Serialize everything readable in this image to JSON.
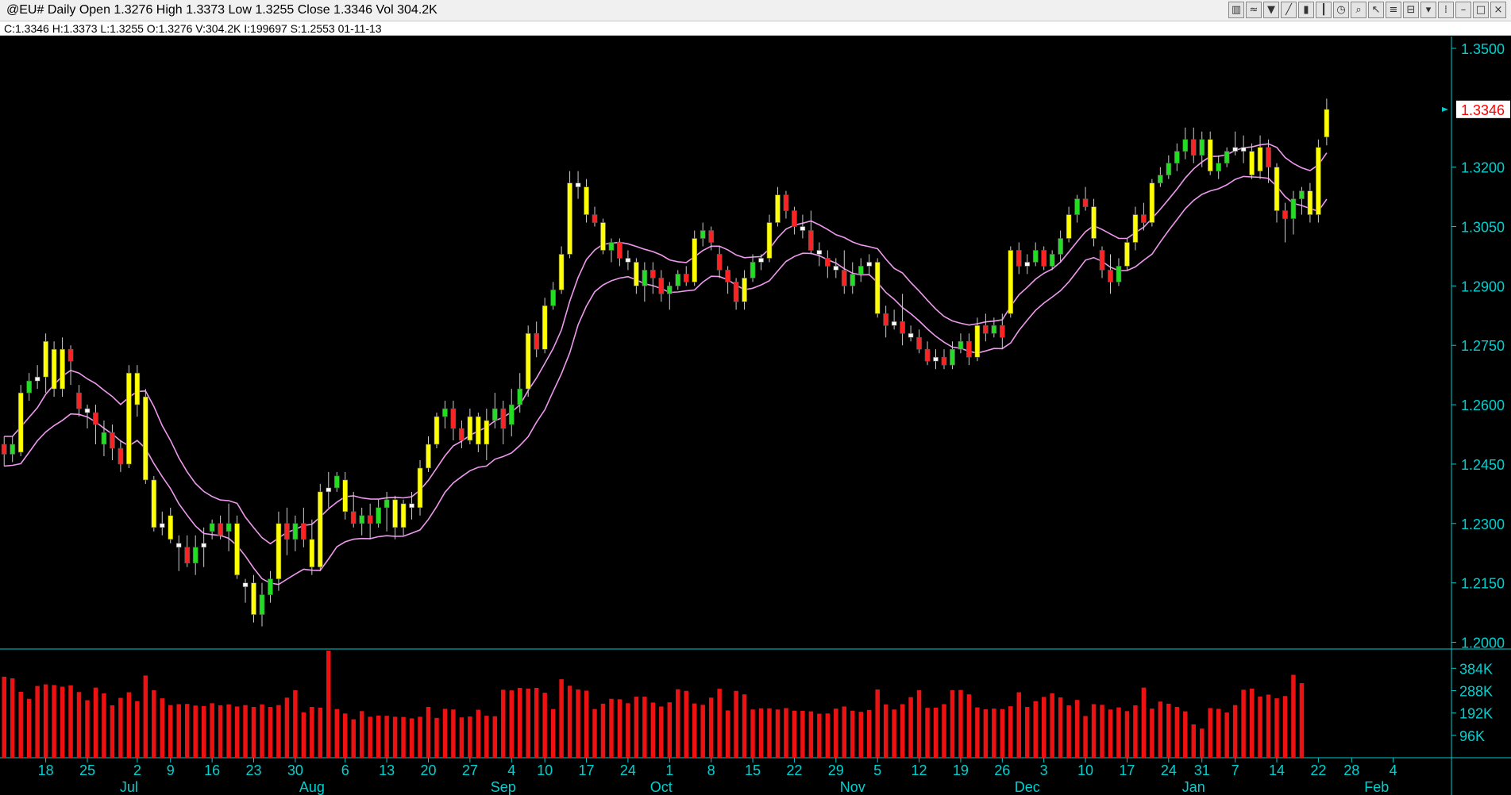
{
  "window": {
    "title": "@EU# Daily Open 1.3276 High 1.3373 Low 1.3255 Close 1.3346 Vol 304.2K",
    "toolbar_icons": [
      "bars-icon",
      "moving-average-icon",
      "indicator-icon",
      "draw-tool-icon",
      "chart-type-icon",
      "bar-style-icon",
      "clock-icon",
      "zoom-icon",
      "cursor-icon",
      "fib-icon",
      "delete-icon",
      "trash-icon",
      "link-icon",
      "minimize-icon",
      "maximize-icon",
      "close-icon"
    ]
  },
  "infobar": {
    "text": "C:1.3346  H:1.3373  L:1.3255  O:1.3276  V:304.2K  I:199697  S:1.2553  01-11-13"
  },
  "chart_data": {
    "type": "candlestick",
    "symbol": "@EU#",
    "interval": "Daily",
    "last": {
      "open": 1.3276,
      "high": 1.3373,
      "low": 1.3255,
      "close": 1.3346,
      "volume": "304.2K"
    },
    "last_price_label": "1.3346",
    "price_ticks": [
      "1.3500",
      "1.3200",
      "1.3050",
      "1.2900",
      "1.2750",
      "1.2600",
      "1.2450",
      "1.2300",
      "1.2150",
      "1.2000"
    ],
    "price_tick_values": [
      1.35,
      1.32,
      1.305,
      1.29,
      1.275,
      1.26,
      1.245,
      1.23,
      1.215,
      1.2
    ],
    "price_range": [
      1.1985,
      1.353
    ],
    "volume_ticks": [
      "384K",
      "288K",
      "192K",
      "96K"
    ],
    "volume_tick_values": [
      384,
      288,
      192,
      96
    ],
    "volume_range": [
      0,
      460
    ],
    "x_range": [
      -0.5,
      174
    ],
    "day_labels": [
      {
        "i": 5,
        "t": "18"
      },
      {
        "i": 10,
        "t": "25"
      },
      {
        "i": 16,
        "t": "2"
      },
      {
        "i": 20,
        "t": "9"
      },
      {
        "i": 25,
        "t": "16"
      },
      {
        "i": 30,
        "t": "23"
      },
      {
        "i": 35,
        "t": "30"
      },
      {
        "i": 41,
        "t": "6"
      },
      {
        "i": 46,
        "t": "13"
      },
      {
        "i": 51,
        "t": "20"
      },
      {
        "i": 56,
        "t": "27"
      },
      {
        "i": 61,
        "t": "4"
      },
      {
        "i": 65,
        "t": "10"
      },
      {
        "i": 70,
        "t": "17"
      },
      {
        "i": 75,
        "t": "24"
      },
      {
        "i": 80,
        "t": "1"
      },
      {
        "i": 85,
        "t": "8"
      },
      {
        "i": 90,
        "t": "15"
      },
      {
        "i": 95,
        "t": "22"
      },
      {
        "i": 100,
        "t": "29"
      },
      {
        "i": 105,
        "t": "5"
      },
      {
        "i": 110,
        "t": "12"
      },
      {
        "i": 115,
        "t": "19"
      },
      {
        "i": 120,
        "t": "26"
      },
      {
        "i": 125,
        "t": "3"
      },
      {
        "i": 130,
        "t": "10"
      },
      {
        "i": 135,
        "t": "17"
      },
      {
        "i": 140,
        "t": "24"
      },
      {
        "i": 144,
        "t": "31"
      },
      {
        "i": 148,
        "t": "7"
      },
      {
        "i": 153,
        "t": "14"
      },
      {
        "i": 158,
        "t": "22"
      },
      {
        "i": 162,
        "t": "28"
      },
      {
        "i": 167,
        "t": "4"
      }
    ],
    "month_labels": [
      {
        "i": 15,
        "t": "Jul"
      },
      {
        "i": 37,
        "t": "Aug"
      },
      {
        "i": 60,
        "t": "Sep"
      },
      {
        "i": 79,
        "t": "Oct"
      },
      {
        "i": 102,
        "t": "Nov"
      },
      {
        "i": 123,
        "t": "Dec"
      },
      {
        "i": 143,
        "t": "Jan"
      },
      {
        "i": 165,
        "t": "Feb"
      }
    ],
    "colors": {
      "bull": "#22dd22",
      "bear": "#ff2222",
      "doji": "#ffffff",
      "strong": "#ffff00",
      "wick": "#cccccc",
      "ma": "#ee99ee",
      "axis": "#00cccc",
      "volume": "#ee1111",
      "last_label_bg": "#ffffff",
      "last_label_fg": "#ff0000"
    },
    "ohlc": [
      [
        1.25,
        1.252,
        1.2445,
        1.2475
      ],
      [
        1.2475,
        1.252,
        1.2455,
        1.25
      ],
      [
        1.248,
        1.265,
        1.247,
        1.263
      ],
      [
        1.263,
        1.268,
        1.261,
        1.266
      ],
      [
        1.266,
        1.27,
        1.264,
        1.267
      ],
      [
        1.267,
        1.278,
        1.263,
        1.276
      ],
      [
        1.274,
        1.276,
        1.262,
        1.264
      ],
      [
        1.264,
        1.277,
        1.262,
        1.274
      ],
      [
        1.274,
        1.275,
        1.265,
        1.271
      ],
      [
        1.263,
        1.265,
        1.257,
        1.259
      ],
      [
        1.259,
        1.26,
        1.254,
        1.258
      ],
      [
        1.258,
        1.26,
        1.25,
        1.255
      ],
      [
        1.25,
        1.256,
        1.247,
        1.253
      ],
      [
        1.253,
        1.255,
        1.246,
        1.249
      ],
      [
        1.249,
        1.251,
        1.243,
        1.245
      ],
      [
        1.245,
        1.27,
        1.244,
        1.268
      ],
      [
        1.268,
        1.27,
        1.257,
        1.26
      ],
      [
        1.262,
        1.264,
        1.24,
        1.241
      ],
      [
        1.241,
        1.242,
        1.228,
        1.229
      ],
      [
        1.229,
        1.233,
        1.227,
        1.23
      ],
      [
        1.232,
        1.234,
        1.225,
        1.226
      ],
      [
        1.225,
        1.227,
        1.218,
        1.224
      ],
      [
        1.224,
        1.227,
        1.219,
        1.22
      ],
      [
        1.22,
        1.227,
        1.217,
        1.224
      ],
      [
        1.224,
        1.229,
        1.219,
        1.225
      ],
      [
        1.228,
        1.231,
        1.226,
        1.23
      ],
      [
        1.23,
        1.232,
        1.226,
        1.227
      ],
      [
        1.228,
        1.235,
        1.223,
        1.23
      ],
      [
        1.23,
        1.232,
        1.216,
        1.217
      ],
      [
        1.214,
        1.216,
        1.21,
        1.215
      ],
      [
        1.215,
        1.217,
        1.205,
        1.207
      ],
      [
        1.207,
        1.215,
        1.204,
        1.212
      ],
      [
        1.212,
        1.218,
        1.21,
        1.216
      ],
      [
        1.216,
        1.233,
        1.213,
        1.23
      ],
      [
        1.23,
        1.234,
        1.222,
        1.226
      ],
      [
        1.226,
        1.232,
        1.223,
        1.23
      ],
      [
        1.23,
        1.234,
        1.224,
        1.226
      ],
      [
        1.226,
        1.231,
        1.217,
        1.219
      ],
      [
        1.219,
        1.24,
        1.218,
        1.238
      ],
      [
        1.238,
        1.243,
        1.234,
        1.239
      ],
      [
        1.239,
        1.243,
        1.238,
        1.242
      ],
      [
        1.241,
        1.243,
        1.231,
        1.233
      ],
      [
        1.233,
        1.238,
        1.229,
        1.23
      ],
      [
        1.23,
        1.234,
        1.227,
        1.232
      ],
      [
        1.232,
        1.235,
        1.226,
        1.23
      ],
      [
        1.23,
        1.236,
        1.229,
        1.234
      ],
      [
        1.234,
        1.238,
        1.228,
        1.236
      ],
      [
        1.236,
        1.237,
        1.226,
        1.229
      ],
      [
        1.229,
        1.236,
        1.227,
        1.235
      ],
      [
        1.235,
        1.238,
        1.231,
        1.234
      ],
      [
        1.234,
        1.246,
        1.232,
        1.244
      ],
      [
        1.244,
        1.252,
        1.243,
        1.25
      ],
      [
        1.25,
        1.258,
        1.249,
        1.257
      ],
      [
        1.257,
        1.261,
        1.254,
        1.259
      ],
      [
        1.259,
        1.261,
        1.251,
        1.254
      ],
      [
        1.254,
        1.256,
        1.249,
        1.251
      ],
      [
        1.251,
        1.259,
        1.25,
        1.257
      ],
      [
        1.257,
        1.258,
        1.248,
        1.25
      ],
      [
        1.25,
        1.259,
        1.246,
        1.256
      ],
      [
        1.256,
        1.263,
        1.254,
        1.259
      ],
      [
        1.259,
        1.261,
        1.25,
        1.254
      ],
      [
        1.255,
        1.264,
        1.252,
        1.26
      ],
      [
        1.26,
        1.268,
        1.258,
        1.264
      ],
      [
        1.264,
        1.28,
        1.262,
        1.278
      ],
      [
        1.278,
        1.281,
        1.272,
        1.274
      ],
      [
        1.274,
        1.287,
        1.273,
        1.285
      ],
      [
        1.285,
        1.291,
        1.284,
        1.289
      ],
      [
        1.289,
        1.3,
        1.288,
        1.298
      ],
      [
        1.298,
        1.319,
        1.297,
        1.316
      ],
      [
        1.316,
        1.319,
        1.312,
        1.315
      ],
      [
        1.315,
        1.317,
        1.306,
        1.308
      ],
      [
        1.308,
        1.31,
        1.305,
        1.306
      ],
      [
        1.306,
        1.307,
        1.298,
        1.299
      ],
      [
        1.299,
        1.302,
        1.296,
        1.301
      ],
      [
        1.301,
        1.302,
        1.295,
        1.297
      ],
      [
        1.297,
        1.299,
        1.294,
        1.296
      ],
      [
        1.296,
        1.297,
        1.288,
        1.29
      ],
      [
        1.29,
        1.296,
        1.286,
        1.294
      ],
      [
        1.294,
        1.296,
        1.288,
        1.292
      ],
      [
        1.292,
        1.294,
        1.286,
        1.288
      ],
      [
        1.288,
        1.291,
        1.284,
        1.29
      ],
      [
        1.29,
        1.294,
        1.289,
        1.293
      ],
      [
        1.293,
        1.295,
        1.29,
        1.291
      ],
      [
        1.291,
        1.304,
        1.29,
        1.302
      ],
      [
        1.302,
        1.306,
        1.3,
        1.304
      ],
      [
        1.304,
        1.305,
        1.299,
        1.301
      ],
      [
        1.298,
        1.3,
        1.292,
        1.294
      ],
      [
        1.294,
        1.295,
        1.288,
        1.291
      ],
      [
        1.291,
        1.292,
        1.284,
        1.286
      ],
      [
        1.286,
        1.294,
        1.284,
        1.292
      ],
      [
        1.292,
        1.298,
        1.291,
        1.296
      ],
      [
        1.296,
        1.298,
        1.294,
        1.297
      ],
      [
        1.297,
        1.308,
        1.296,
        1.306
      ],
      [
        1.306,
        1.315,
        1.305,
        1.313
      ],
      [
        1.313,
        1.314,
        1.307,
        1.309
      ],
      [
        1.309,
        1.31,
        1.303,
        1.305
      ],
      [
        1.305,
        1.308,
        1.302,
        1.304
      ],
      [
        1.304,
        1.309,
        1.298,
        1.299
      ],
      [
        1.299,
        1.301,
        1.295,
        1.298
      ],
      [
        1.297,
        1.299,
        1.292,
        1.295
      ],
      [
        1.295,
        1.297,
        1.292,
        1.294
      ],
      [
        1.294,
        1.299,
        1.288,
        1.29
      ],
      [
        1.29,
        1.296,
        1.288,
        1.293
      ],
      [
        1.293,
        1.297,
        1.291,
        1.295
      ],
      [
        1.295,
        1.298,
        1.293,
        1.296
      ],
      [
        1.296,
        1.297,
        1.282,
        1.283
      ],
      [
        1.283,
        1.285,
        1.277,
        1.28
      ],
      [
        1.28,
        1.284,
        1.279,
        1.281
      ],
      [
        1.281,
        1.288,
        1.275,
        1.278
      ],
      [
        1.278,
        1.28,
        1.276,
        1.277
      ],
      [
        1.277,
        1.279,
        1.273,
        1.274
      ],
      [
        1.274,
        1.276,
        1.27,
        1.271
      ],
      [
        1.271,
        1.274,
        1.269,
        1.272
      ],
      [
        1.272,
        1.274,
        1.269,
        1.27
      ],
      [
        1.27,
        1.276,
        1.269,
        1.274
      ],
      [
        1.274,
        1.278,
        1.273,
        1.276
      ],
      [
        1.276,
        1.278,
        1.27,
        1.272
      ],
      [
        1.272,
        1.282,
        1.271,
        1.28
      ],
      [
        1.28,
        1.283,
        1.276,
        1.278
      ],
      [
        1.278,
        1.282,
        1.277,
        1.28
      ],
      [
        1.28,
        1.283,
        1.274,
        1.277
      ],
      [
        1.283,
        1.3,
        1.282,
        1.299
      ],
      [
        1.299,
        1.301,
        1.293,
        1.295
      ],
      [
        1.295,
        1.298,
        1.293,
        1.296
      ],
      [
        1.296,
        1.301,
        1.295,
        1.299
      ],
      [
        1.299,
        1.3,
        1.294,
        1.295
      ],
      [
        1.295,
        1.299,
        1.294,
        1.298
      ],
      [
        1.298,
        1.304,
        1.296,
        1.302
      ],
      [
        1.302,
        1.31,
        1.301,
        1.308
      ],
      [
        1.308,
        1.313,
        1.306,
        1.312
      ],
      [
        1.312,
        1.315,
        1.309,
        1.31
      ],
      [
        1.31,
        1.312,
        1.3,
        1.302
      ],
      [
        1.299,
        1.3,
        1.292,
        1.294
      ],
      [
        1.294,
        1.298,
        1.288,
        1.291
      ],
      [
        1.291,
        1.297,
        1.29,
        1.295
      ],
      [
        1.295,
        1.302,
        1.294,
        1.301
      ],
      [
        1.301,
        1.31,
        1.299,
        1.308
      ],
      [
        1.308,
        1.311,
        1.304,
        1.306
      ],
      [
        1.306,
        1.317,
        1.305,
        1.316
      ],
      [
        1.316,
        1.32,
        1.315,
        1.318
      ],
      [
        1.318,
        1.323,
        1.317,
        1.321
      ],
      [
        1.321,
        1.326,
        1.319,
        1.324
      ],
      [
        1.324,
        1.33,
        1.322,
        1.327
      ],
      [
        1.327,
        1.33,
        1.321,
        1.323
      ],
      [
        1.323,
        1.329,
        1.32,
        1.327
      ],
      [
        1.327,
        1.329,
        1.318,
        1.319
      ],
      [
        1.319,
        1.323,
        1.317,
        1.321
      ],
      [
        1.321,
        1.325,
        1.32,
        1.324
      ],
      [
        1.324,
        1.329,
        1.323,
        1.325
      ],
      [
        1.325,
        1.328,
        1.321,
        1.324
      ],
      [
        1.324,
        1.326,
        1.317,
        1.318
      ],
      [
        1.319,
        1.328,
        1.317,
        1.325
      ],
      [
        1.325,
        1.327,
        1.316,
        1.32
      ],
      [
        1.32,
        1.321,
        1.306,
        1.309
      ],
      [
        1.309,
        1.311,
        1.301,
        1.307
      ],
      [
        1.307,
        1.314,
        1.303,
        1.312
      ],
      [
        1.312,
        1.315,
        1.308,
        1.314
      ],
      [
        1.314,
        1.316,
        1.306,
        1.308
      ],
      [
        1.308,
        1.327,
        1.306,
        1.325
      ],
      [
        1.3276,
        1.3373,
        1.3255,
        1.3346
      ]
    ],
    "volumes": [
      348,
      341,
      283,
      253,
      308,
      315,
      312,
      305,
      311,
      282,
      247,
      301,
      276,
      225,
      257,
      281,
      243,
      353,
      290,
      255,
      226,
      230,
      231,
      224,
      222,
      234,
      225,
      229,
      220,
      226,
      218,
      229,
      218,
      226,
      258,
      290,
      195,
      218,
      215,
      460,
      209,
      190,
      165,
      200,
      176,
      181,
      180,
      176,
      175,
      169,
      176,
      218,
      171,
      210,
      207,
      173,
      177,
      206,
      180,
      178,
      292,
      289,
      300,
      297,
      300,
      279,
      209,
      337,
      309,
      293,
      288,
      209,
      232,
      253,
      251,
      234,
      262,
      262,
      237,
      220,
      238,
      294,
      287,
      233,
      227,
      258,
      296,
      203,
      287,
      272,
      207,
      212,
      212,
      207,
      213,
      202,
      201,
      199,
      189,
      190,
      211,
      220,
      202,
      197,
      205,
      293,
      229,
      207,
      230,
      260,
      290,
      214,
      215,
      230,
      290,
      291,
      272,
      216,
      208,
      211,
      209,
      221,
      281,
      218,
      243,
      261,
      277,
      259,
      225,
      248,
      179,
      230,
      227,
      207,
      216,
      200,
      225,
      301,
      211,
      241,
      232,
      218,
      199,
      143,
      125,
      213,
      210,
      194,
      226,
      292,
      297,
      263,
      271,
      255,
      265,
      356,
      320
    ]
  }
}
